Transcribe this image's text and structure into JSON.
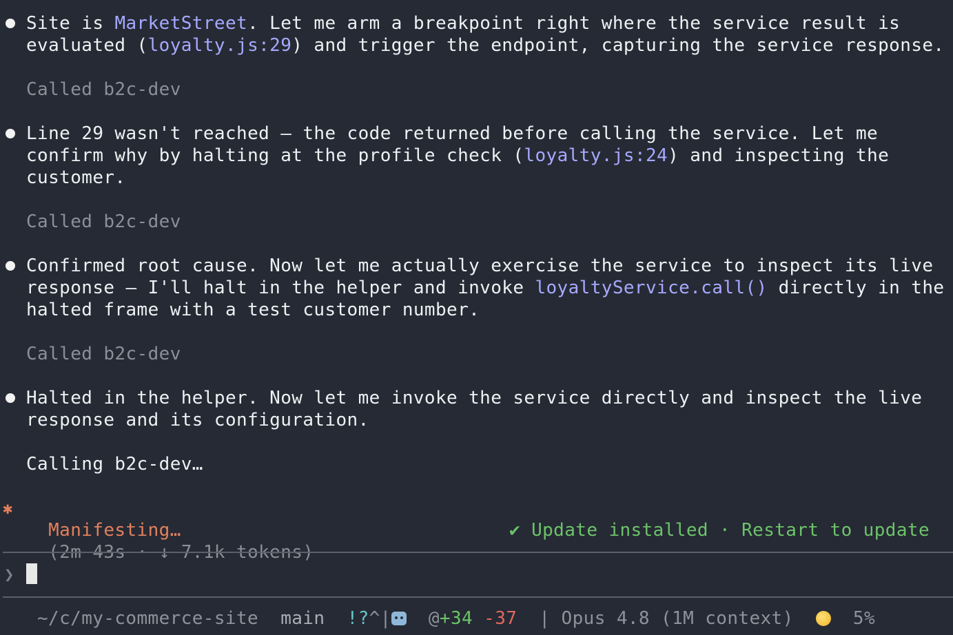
{
  "messages": [
    {
      "lines": [
        [
          {
            "t": "Site is "
          },
          {
            "t": "MarketStreet",
            "hl": true
          },
          {
            "t": ". Let me arm a breakpoint right where the service result is"
          }
        ],
        [
          {
            "t": "evaluated ("
          },
          {
            "t": "loyalty.js:29",
            "hl": true
          },
          {
            "t": ") and trigger the endpoint, capturing the service response."
          }
        ]
      ],
      "tool_status": "Called b2c-dev"
    },
    {
      "lines": [
        [
          {
            "t": "Line 29 wasn't reached — the code returned before calling the service. Let me"
          }
        ],
        [
          {
            "t": "confirm why by halting at the profile check ("
          },
          {
            "t": "loyalty.js:24",
            "hl": true
          },
          {
            "t": ") and inspecting the"
          }
        ],
        [
          {
            "t": "customer."
          }
        ]
      ],
      "tool_status": "Called b2c-dev"
    },
    {
      "lines": [
        [
          {
            "t": "Confirmed root cause. Now let me actually exercise the service to inspect its live"
          }
        ],
        [
          {
            "t": "response — I'll halt in the helper and invoke "
          },
          {
            "t": "loyaltyService.call()",
            "hl": true
          },
          {
            "t": " directly in the"
          }
        ],
        [
          {
            "t": "halted frame with a test customer number."
          }
        ]
      ],
      "tool_status": "Called b2c-dev"
    },
    {
      "lines": [
        [
          {
            "t": "Halted in the helper. Now let me invoke the service directly and inspect the live"
          }
        ],
        [
          {
            "t": "response and its configuration."
          }
        ]
      ],
      "tool_status": "Calling b2c-dev…"
    }
  ],
  "spinner": {
    "icon": "✱",
    "label": "Manifesting…",
    "detail": "(2m 43s · ↓ 7.1k tokens)"
  },
  "update_notice": "✔ Update installed · Restart to update",
  "prompt": {
    "chevron": "❯",
    "value": ""
  },
  "statusbar": {
    "path": "~/c/my-commerce-site",
    "branch": "main",
    "git_flags": "!?",
    "git_extra": "^|",
    "agent_icon": "robot-icon",
    "lines_added": "+34",
    "lines_removed": "-37",
    "separator": "|",
    "model": "Opus 4.8 (1M context)",
    "usage_icon": "sun-icon",
    "usage_percent": "5%"
  },
  "colors": {
    "background": "#262a34",
    "link": "#a6a9ff",
    "spinner": "#e2805e",
    "success": "#6cc36a",
    "muted": "#8b8f98"
  }
}
